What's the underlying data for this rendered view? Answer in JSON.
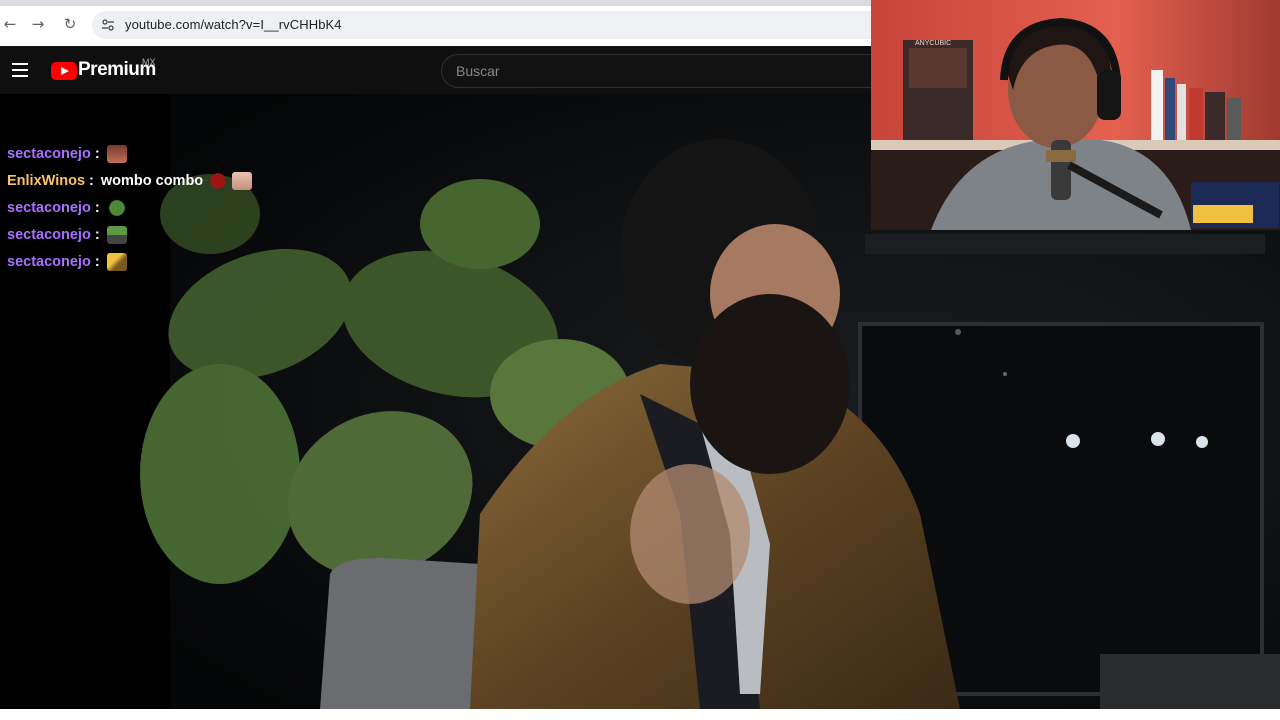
{
  "browser": {
    "back_icon": "arrow-left-icon",
    "forward_icon": "arrow-right-icon",
    "reload_icon": "reload-icon",
    "site_info_icon": "tune-icon",
    "url": "youtube.com/watch?v=I__rvCHHbK4"
  },
  "youtube": {
    "menu_icon": "hamburger-icon",
    "brand": "Premium",
    "region": "MX",
    "search_placeholder": "Buscar"
  },
  "chat": {
    "messages": [
      {
        "user": "sectaconejo",
        "sep": ":",
        "text": "",
        "emotes": [
          "face-emote"
        ],
        "user_color": "#a970ff"
      },
      {
        "user": "EnlixWinos",
        "sep": ":",
        "text": "wombo combo",
        "emotes": [
          "red-blob-emote",
          "face-emote"
        ],
        "user_color": "#f5c56a"
      },
      {
        "user": "sectaconejo",
        "sep": ":",
        "text": "",
        "emotes": [
          "frog-emote"
        ],
        "user_color": "#a970ff"
      },
      {
        "user": "sectaconejo",
        "sep": ":",
        "text": "",
        "emotes": [
          "frog-car-emote"
        ],
        "user_color": "#a970ff"
      },
      {
        "user": "sectaconejo",
        "sep": ":",
        "text": "",
        "emotes": [
          "yellow-figure-emote"
        ],
        "user_color": "#a970ff"
      }
    ]
  },
  "webcam": {
    "brand_text": "ANYCUBIC"
  },
  "colors": {
    "youtube_red": "#ff0000",
    "header_bg": "#0f0f0f",
    "chat_user_purple": "#a970ff",
    "chat_user_gold": "#f5c56a"
  }
}
